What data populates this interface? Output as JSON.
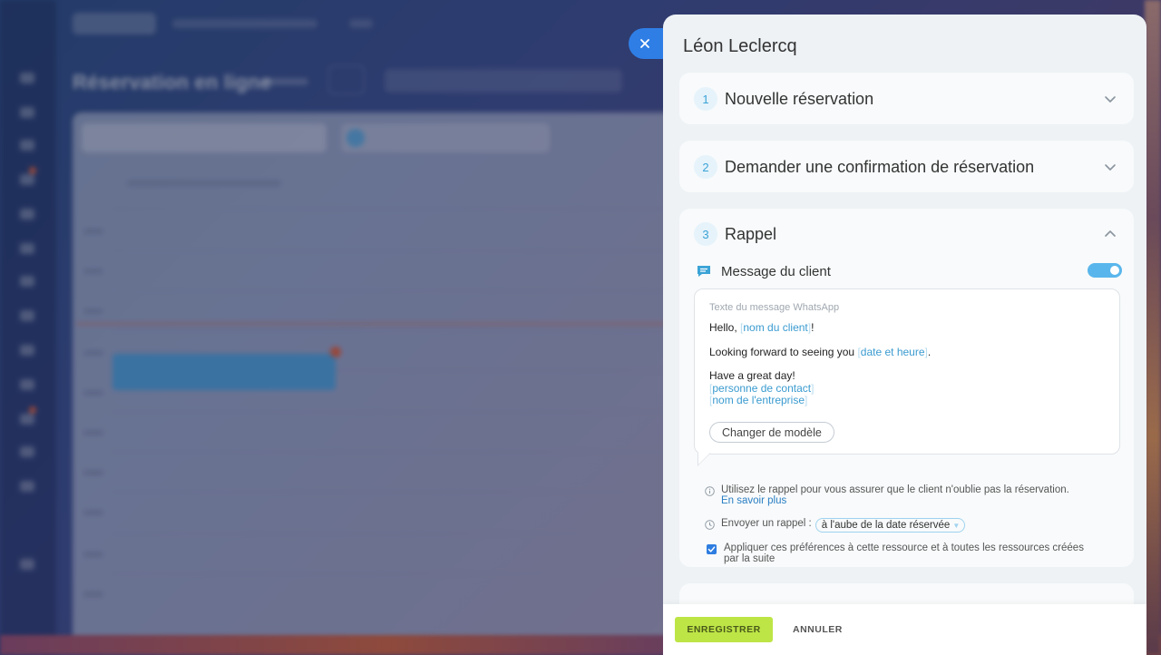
{
  "panel": {
    "title": "Léon Leclercq"
  },
  "sections": [
    {
      "number": "1",
      "title": "Nouvelle réservation",
      "expanded": false
    },
    {
      "number": "2",
      "title": "Demander une confirmation de réservation",
      "expanded": false
    },
    {
      "number": "3",
      "title": "Rappel",
      "expanded": true
    }
  ],
  "reminder": {
    "message_label": "Message du client",
    "toggle_on": true,
    "message": {
      "placeholder": "Texte du message WhatsApp",
      "greeting": "Hello,",
      "tag_client_name": "nom du client",
      "greeting_end": "!",
      "forward": "Looking forward to seeing you",
      "tag_date_time": "date et heure",
      "forward_end": ".",
      "closing": "Have a great day!",
      "tag_contact_person": "personne de contact",
      "tag_company_name": "nom de l'entreprise"
    },
    "change_template_label": "Changer de modèle",
    "info_text": "Utilisez le rappel pour vous assurer que le client n'oublie pas la réservation.",
    "learn_more": "En savoir plus",
    "send_label": "Envoyer un rappel :",
    "send_value": "à l'aube de la date réservée",
    "apply_checked": true,
    "apply_text_line1": "Appliquer ces préférences à cette ressource et à toutes les ressources créées",
    "apply_text_line2": "par la suite"
  },
  "footer": {
    "save_label": "ENREGISTRER",
    "cancel_label": "ANNULER"
  },
  "background": {
    "page_title": "Réservation en ligne"
  },
  "colors": {
    "accent_blue": "#2f7ee6",
    "section_number": "#3ba3d6",
    "tag_color": "#3a9bd0",
    "save_button": "#bde546",
    "toggle": "#59b6ec"
  }
}
